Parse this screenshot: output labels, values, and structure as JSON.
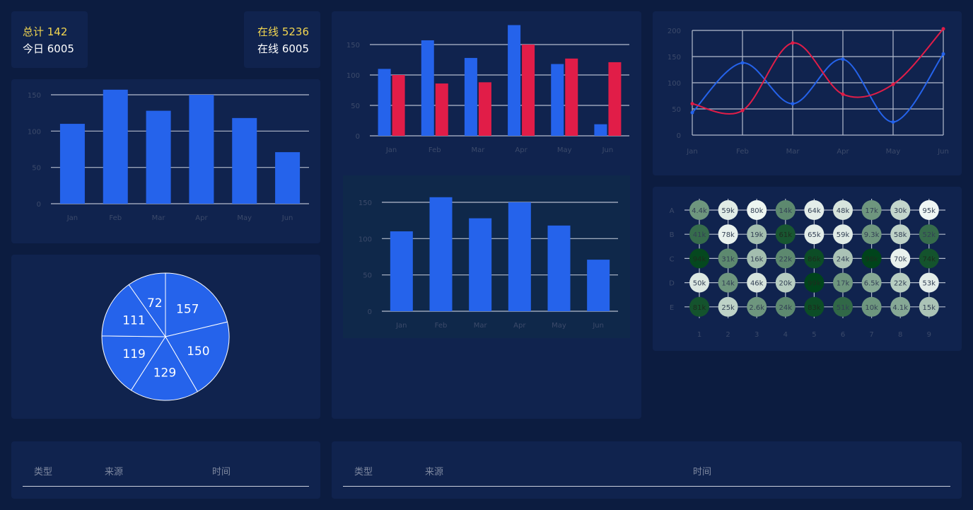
{
  "stats": {
    "total_label": "总计 142",
    "today_label": "今日 6005",
    "online_hl_label": "在线 5236",
    "online_label": "在线 6005"
  },
  "colors": {
    "blue": "#2563eb",
    "red": "#e11d48",
    "grid": "#b3bccd",
    "tick": "#3c4a6a"
  },
  "chart_data": [
    {
      "type": "bar",
      "categories": [
        "Jan",
        "Feb",
        "Mar",
        "Apr",
        "May",
        "Jun"
      ],
      "series": [
        {
          "values": [
            110,
            157,
            128,
            150,
            118,
            71
          ]
        }
      ],
      "ylim": [
        0,
        150
      ],
      "yticks": [
        0,
        50,
        100,
        150
      ]
    },
    {
      "type": "bar",
      "categories": [
        "Jan",
        "Feb",
        "Mar",
        "Apr",
        "May",
        "Jun"
      ],
      "series": [
        {
          "values": [
            110,
            157,
            128,
            182,
            118,
            19
          ],
          "color": "#2563eb"
        },
        {
          "values": [
            100,
            86,
            88,
            150,
            127,
            121
          ],
          "color": "#e11d48"
        }
      ],
      "ylim": [
        0,
        150
      ],
      "yticks": [
        0,
        50,
        100,
        150
      ]
    },
    {
      "type": "bar",
      "categories": [
        "Jan",
        "Feb",
        "Mar",
        "Apr",
        "May",
        "Jun"
      ],
      "series": [
        {
          "values": [
            110,
            157,
            128,
            150,
            118,
            71
          ]
        }
      ],
      "ylim": [
        0,
        150
      ],
      "yticks": [
        0,
        50,
        100,
        150
      ]
    },
    {
      "type": "line",
      "categories": [
        "Jan",
        "Feb",
        "Mar",
        "Apr",
        "May",
        "Jun"
      ],
      "series": [
        {
          "values": [
            43,
            138,
            60,
            145,
            25,
            155
          ],
          "color": "#2563eb"
        },
        {
          "values": [
            60,
            47,
            176,
            78,
            97,
            203
          ],
          "color": "#e11d48"
        }
      ],
      "ylim": [
        0,
        200
      ],
      "yticks": [
        0,
        50,
        100,
        150,
        200
      ]
    },
    {
      "type": "pie",
      "values": [
        157,
        150,
        129,
        119,
        111,
        72
      ],
      "labels": [
        "157",
        "150",
        "129",
        "119",
        "111",
        "72"
      ]
    },
    {
      "type": "heatmap",
      "rows": [
        "A",
        "B",
        "C",
        "D",
        "E"
      ],
      "cols": [
        "1",
        "2",
        "3",
        "4",
        "5",
        "6",
        "7",
        "8",
        "9"
      ],
      "labels": [
        [
          "4.4k",
          "59k",
          "80k",
          "14k",
          "64k",
          "48k",
          "17k",
          "30k",
          "95k"
        ],
        [
          "41k",
          "78k",
          "19k",
          "61k",
          "65k",
          "59k",
          "9.3k",
          "58k",
          "52k"
        ],
        [
          "94k",
          "31k",
          "16k",
          "22k",
          "86k",
          "24k",
          "98k",
          "70k",
          "74k"
        ],
        [
          "50k",
          "14k",
          "46k",
          "20k",
          "99k",
          "17k",
          "6.5k",
          "22k",
          "53k"
        ],
        [
          "81k",
          "25k",
          "2.6k",
          "24k",
          "83k",
          "51k",
          "10k",
          "4.1k",
          "15k"
        ]
      ],
      "values": [
        [
          0.55,
          0.08,
          0.03,
          0.62,
          0.07,
          0.12,
          0.55,
          0.2,
          0.02
        ],
        [
          0.78,
          0.05,
          0.33,
          0.9,
          0.07,
          0.08,
          0.55,
          0.22,
          0.78
        ],
        [
          0.98,
          0.62,
          0.33,
          0.62,
          0.95,
          0.3,
          1.0,
          0.05,
          0.92
        ],
        [
          0.1,
          0.55,
          0.12,
          0.25,
          1.0,
          0.55,
          0.45,
          0.25,
          0.07
        ],
        [
          0.92,
          0.22,
          0.55,
          0.62,
          0.95,
          0.8,
          0.55,
          0.45,
          0.3
        ]
      ]
    }
  ],
  "tables": [
    {
      "headers": [
        "类型",
        "来源",
        "时间"
      ]
    },
    {
      "headers": [
        "类型",
        "来源",
        "时间"
      ]
    }
  ]
}
